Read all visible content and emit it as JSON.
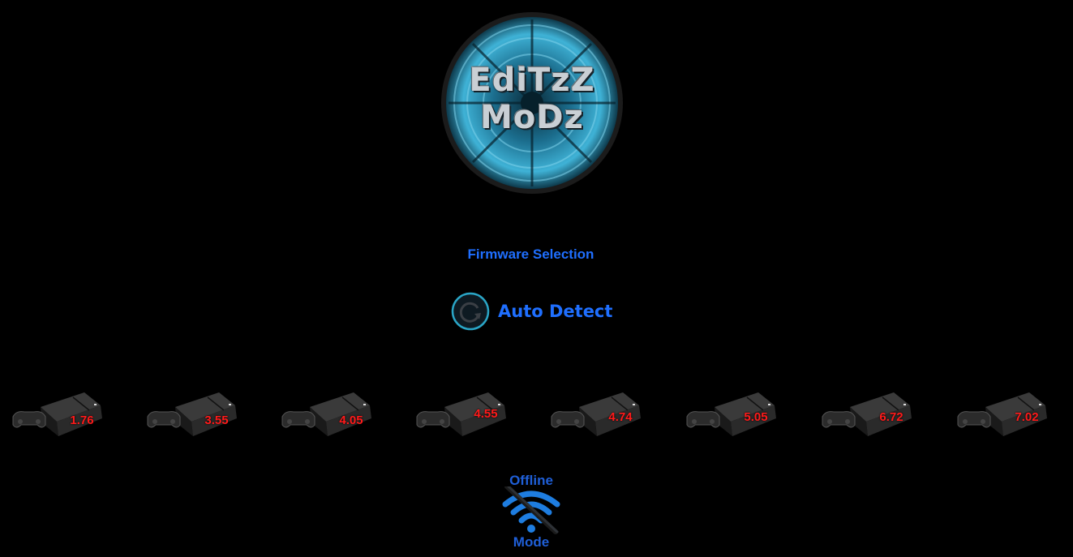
{
  "logo": {
    "line1": "EdiTzZ",
    "line2": "MoDz"
  },
  "firmware_selection": {
    "title": "Firmware Selection"
  },
  "auto_detect": {
    "label": "Auto Detect",
    "icon": "refresh-icon"
  },
  "consoles": [
    {
      "firmware": "1.76",
      "icon": "ps4-console-icon"
    },
    {
      "firmware": "3.55",
      "icon": "ps4-console-icon"
    },
    {
      "firmware": "4.05",
      "icon": "ps4-console-icon"
    },
    {
      "firmware": "4.55",
      "icon": "ps4-console-icon"
    },
    {
      "firmware": "4.74",
      "icon": "ps4-console-icon"
    },
    {
      "firmware": "5.05",
      "icon": "ps4-console-icon"
    },
    {
      "firmware": "6.72",
      "icon": "ps4-console-icon"
    },
    {
      "firmware": "7.02",
      "icon": "ps4-console-icon"
    }
  ],
  "offline_mode": {
    "line1": "Offline",
    "line2": "Mode",
    "icon": "wifi-off-icon"
  },
  "colors": {
    "background": "#000000",
    "accent_blue": "#1f6fff",
    "firmware_red": "#ff1a1a",
    "logo_teal": "#2a9fc4"
  }
}
